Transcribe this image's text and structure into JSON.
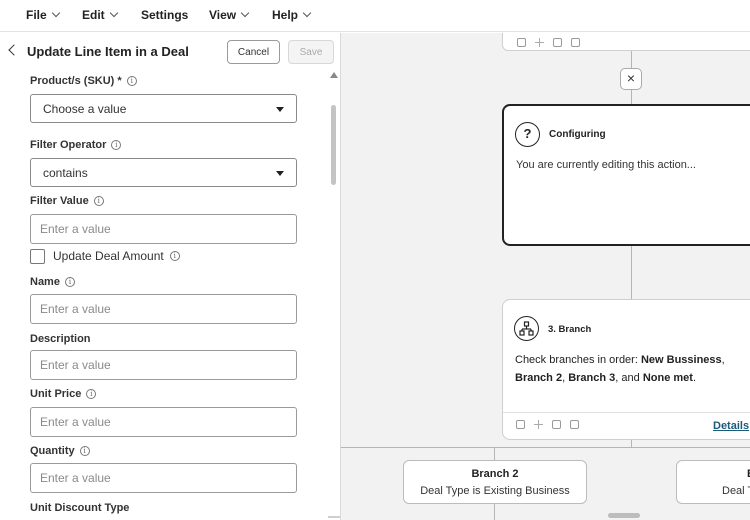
{
  "menu": [
    {
      "label": "File",
      "has_chevron": true
    },
    {
      "label": "Edit",
      "has_chevron": true
    },
    {
      "label": "Settings",
      "has_chevron": false
    },
    {
      "label": "View",
      "has_chevron": true
    },
    {
      "label": "Help",
      "has_chevron": true
    }
  ],
  "panel": {
    "title": "Update Line Item in a Deal",
    "cancel_label": "Cancel",
    "save_label": "Save"
  },
  "form": {
    "product_label": "Product/s (SKU) *",
    "product_value": "Choose a value",
    "filter_operator_label": "Filter Operator",
    "filter_operator_value": "contains",
    "filter_value_label": "Filter Value",
    "filter_value_placeholder": "Enter a value",
    "update_deal_amount_label": "Update Deal Amount",
    "name_label": "Name",
    "name_placeholder": "Enter a value",
    "description_label": "Description",
    "description_placeholder": "Enter a value",
    "unit_price_label": "Unit Price",
    "unit_price_placeholder": "Enter a value",
    "quantity_label": "Quantity",
    "quantity_placeholder": "Enter a value",
    "unit_discount_type_label": "Unit Discount Type"
  },
  "canvas": {
    "configuring": {
      "title": "Configuring",
      "text": "You are currently editing this action...",
      "icon": "question-icon"
    },
    "branch_step": {
      "title": "3. Branch",
      "text_prefix": "Check branches in order: ",
      "branch_a": "New Bussiness",
      "sep1": ",",
      "branch_b": "Branch 2",
      "sep2": ", ",
      "branch_c": "Branch 3",
      "sep3": ", and ",
      "branch_d": "None met",
      "sep4": ".",
      "details_label": "Details",
      "icon": "branch-icon"
    },
    "branches": [
      {
        "title": "Branch 2",
        "subtitle": "Deal Type is Existing Business"
      },
      {
        "title": "B",
        "subtitle": "Deal T"
      }
    ]
  }
}
